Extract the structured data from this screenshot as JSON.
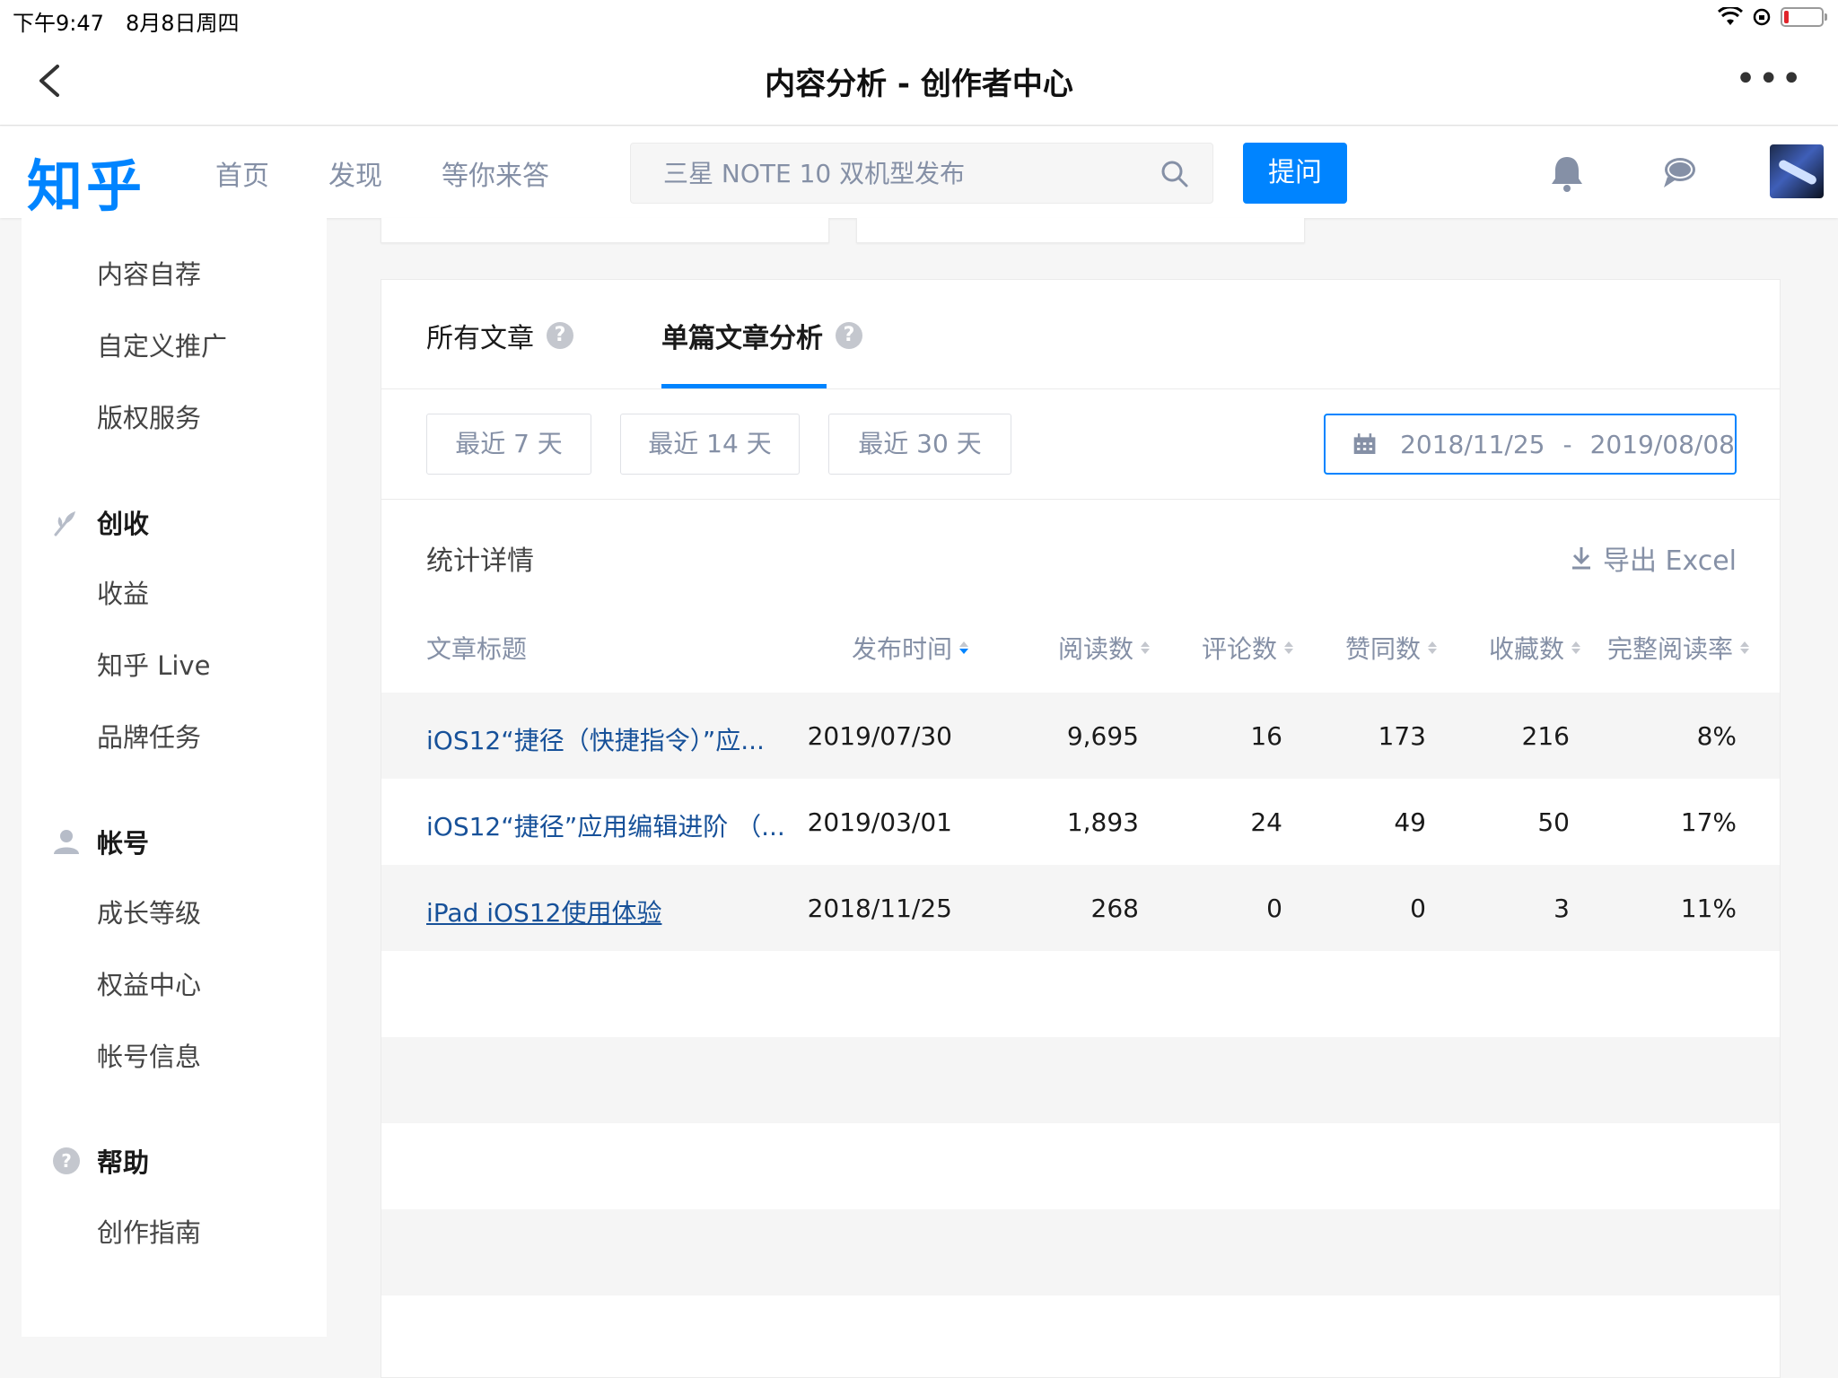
{
  "status_bar": {
    "time": "下午9:47",
    "date": "8月8日周四"
  },
  "nav_bar": {
    "title": "内容分析 - 创作者中心",
    "more": "•••"
  },
  "header": {
    "logo": "知乎",
    "nav": [
      "首页",
      "发现",
      "等你来答"
    ],
    "search_placeholder": "三星 NOTE 10 双机型发布",
    "ask_button": "提问",
    "brand_color": "#0084ff"
  },
  "sidebar": {
    "top_items": [
      "内容自荐",
      "自定义推广",
      "版权服务"
    ],
    "sections": [
      {
        "title": "创收",
        "icon": "sprout-icon",
        "items": [
          "收益",
          "知乎 Live",
          "品牌任务"
        ]
      },
      {
        "title": "帐号",
        "icon": "user-icon",
        "items": [
          "成长等级",
          "权益中心",
          "帐号信息"
        ]
      },
      {
        "title": "帮助",
        "icon": "help-icon",
        "items": [
          "创作指南"
        ]
      }
    ]
  },
  "main": {
    "tabs": [
      {
        "label": "所有文章",
        "help": "?"
      },
      {
        "label": "单篇文章分析",
        "help": "?",
        "active": true
      }
    ],
    "ranges": [
      "最近 7 天",
      "最近 14 天",
      "最近 30 天"
    ],
    "date_range": {
      "start": "2018/11/25",
      "separator": "-",
      "end": "2019/08/08"
    },
    "stats_title": "统计详情",
    "export_label": "导出 Excel",
    "columns": [
      "文章标题",
      "发布时间",
      "阅读数",
      "评论数",
      "赞同数",
      "收藏数",
      "完整阅读率"
    ],
    "rows": [
      {
        "title": "iOS12“捷径（快捷指令）”应...",
        "date": "2019/07/30",
        "reads": "9,695",
        "comments": "16",
        "likes": "173",
        "favorites": "216",
        "rate": "8%"
      },
      {
        "title": "iOS12“捷径”应用编辑进阶 （...",
        "date": "2019/03/01",
        "reads": "1,893",
        "comments": "24",
        "likes": "49",
        "favorites": "50",
        "rate": "17%"
      },
      {
        "title": "iPad iOS12使用体验",
        "date": "2018/11/25",
        "reads": "268",
        "comments": "0",
        "likes": "0",
        "favorites": "3",
        "rate": "11%"
      }
    ]
  }
}
